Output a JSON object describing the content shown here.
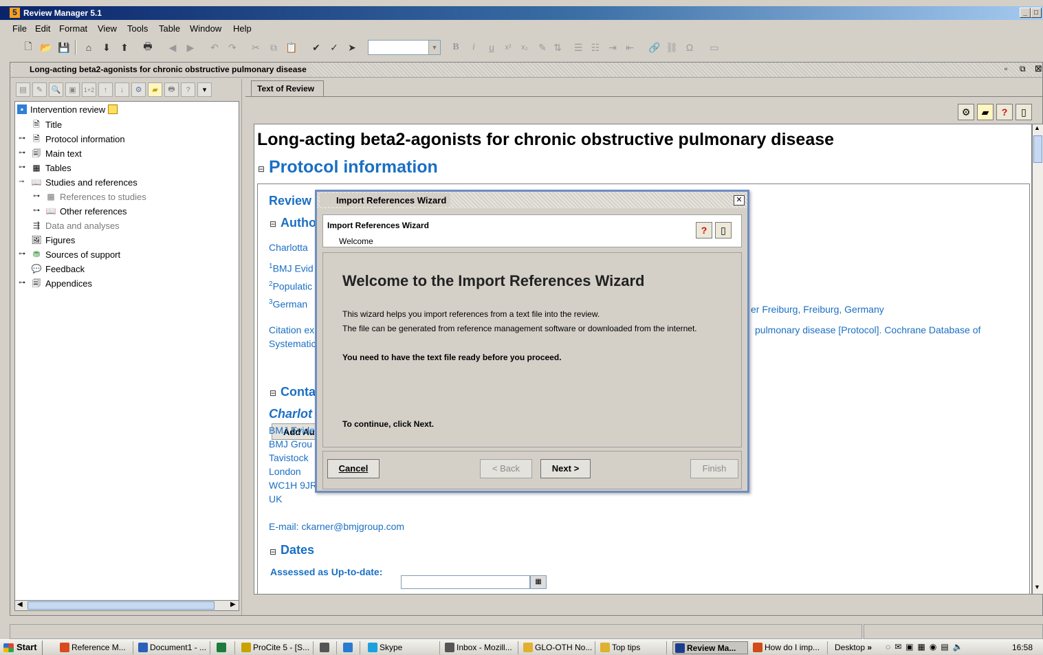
{
  "window": {
    "title": "Review Manager 5.1",
    "app_icon_glyph": "5",
    "controls": [
      "minimize",
      "restore"
    ]
  },
  "menu": [
    "File",
    "Edit",
    "Format",
    "View",
    "Tools",
    "Table",
    "Window",
    "Help"
  ],
  "toolbar": {
    "icons": [
      "new-icon",
      "open-icon",
      "save-icon",
      "home-icon",
      "download-icon",
      "upload-icon",
      "print-icon",
      "back-arrow-icon",
      "forward-arrow-icon",
      "undo-icon",
      "redo-icon",
      "cut-icon",
      "copy-icon",
      "paste-icon",
      "spellcheck-icon",
      "abc-check-icon",
      "wizard-icon"
    ],
    "style_combo_value": "",
    "format_glyphs": {
      "bold": "B",
      "italic": "i",
      "underline": "u",
      "superscript": "x²",
      "subscript": "x₂",
      "omega": "Ω"
    }
  },
  "document": {
    "title": "Long-acting beta2-agonists for chronic obstructive pulmonary disease",
    "tab": "Text of Review"
  },
  "tree": {
    "root": "Intervention review",
    "items": [
      {
        "label": "Title",
        "icon": "document-icon",
        "state": "normal"
      },
      {
        "label": "Protocol information",
        "icon": "document-icon",
        "state": "normal"
      },
      {
        "label": "Main text",
        "icon": "pages-icon",
        "state": "normal"
      },
      {
        "label": "Tables",
        "icon": "table-icon",
        "state": "normal"
      },
      {
        "label": "Studies and references",
        "icon": "book-icon",
        "state": "normal"
      },
      {
        "label": "References to studies",
        "icon": "references-icon",
        "state": "disabled"
      },
      {
        "label": "Other references",
        "icon": "book-icon",
        "state": "normal"
      },
      {
        "label": "Data and analyses",
        "icon": "analysis-icon",
        "state": "disabled"
      },
      {
        "label": "Figures",
        "icon": "image-icon",
        "state": "normal"
      },
      {
        "label": "Sources of support",
        "icon": "support-icon",
        "state": "normal"
      },
      {
        "label": "Feedback",
        "icon": "feedback-icon",
        "state": "normal"
      },
      {
        "label": "Appendices",
        "icon": "pages-icon",
        "state": "normal"
      }
    ]
  },
  "editor": {
    "title": "Long-acting beta2-agonists for chronic obstructive pulmonary disease",
    "section_protocol": "Protocol information",
    "review_frag": "Review",
    "authors_frag": "Autho",
    "author_line_frag": "Charlotta",
    "aff1_sup": "1",
    "aff1_frag": "BMJ Evid",
    "aff2_sup": "2",
    "aff2_frag": "Populatic",
    "aff3_sup": "3",
    "aff3_frag": "German",
    "aff3_right": "er Freiburg, Freiburg, Germany",
    "citation_frag": "Citation ex",
    "citation_right": "pulmonary disease [Protocol]. Cochrane Database of",
    "systematic_frag": "Systematic",
    "add_author_label": "Add Autl",
    "contact_frag": "Conta",
    "contact_name_frag": "Charlot",
    "address": [
      "BMJ Evide",
      "BMJ Grou",
      "Tavistock",
      "London",
      "WC1H 9JR",
      "UK"
    ],
    "email": "E-mail: ckarner@bmjgroup.com",
    "dates": "Dates",
    "assessed_label": "Assessed as Up-to-date:",
    "assessed_value": ""
  },
  "dialog": {
    "title": "Import References Wizard",
    "header_title": "Import References Wizard",
    "header_sub": "Welcome",
    "welcome": "Welcome to the Import References Wizard",
    "line1": "This wizard helps you import references from a text file into the review.",
    "line2": "The file can be generated from reference management software or downloaded from the internet.",
    "line3": "You need to have the text file ready before you proceed.",
    "line4": "To continue, click Next.",
    "buttons": {
      "cancel": "Cancel",
      "back": "< Back",
      "next": "Next >",
      "finish": "Finish"
    }
  },
  "taskbar": {
    "start": "Start",
    "tasks": [
      {
        "label": "Reference M...",
        "color": "#d94a1e",
        "active": false
      },
      {
        "label": "Document1 - ...",
        "color": "#2b5fb8",
        "active": false
      },
      {
        "label": "",
        "color": "#1e7b3c",
        "active": false
      },
      {
        "label": "ProCite 5 - [S...",
        "color": "#c9a200",
        "active": false
      },
      {
        "label": "",
        "color": "#555555",
        "active": false
      },
      {
        "label": "",
        "color": "#2a7ad0",
        "active": false
      },
      {
        "label": "Skype",
        "color": "#1ea0dc",
        "active": false
      },
      {
        "label": "Inbox - Mozill...",
        "color": "#555555",
        "active": false
      },
      {
        "label": "GLO-OTH No...",
        "color": "#e0b030",
        "active": false
      },
      {
        "label": "Top tips",
        "color": "#e0b030",
        "active": false
      },
      {
        "label": "Review Ma...",
        "color": "#1a3d8f",
        "active": true
      },
      {
        "label": "How do I imp...",
        "color": "#d04a1a",
        "active": false
      }
    ],
    "desktop": "Desktop",
    "chevron": "»",
    "clock": "16:58"
  }
}
